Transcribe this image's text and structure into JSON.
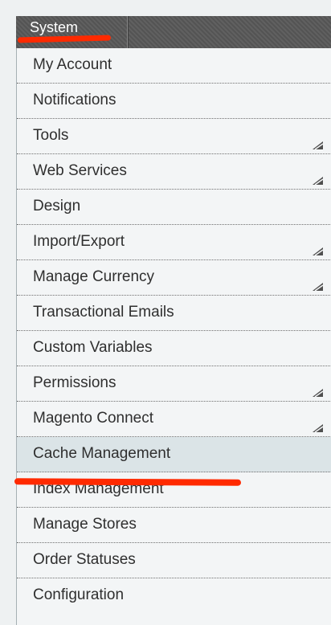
{
  "nav": {
    "system_label": "System"
  },
  "menu": {
    "items": [
      {
        "label": "My Account",
        "has_submenu": false
      },
      {
        "label": "Notifications",
        "has_submenu": false
      },
      {
        "label": "Tools",
        "has_submenu": true
      },
      {
        "label": "Web Services",
        "has_submenu": true
      },
      {
        "label": "Design",
        "has_submenu": false
      },
      {
        "label": "Import/Export",
        "has_submenu": true
      },
      {
        "label": "Manage Currency",
        "has_submenu": true
      },
      {
        "label": "Transactional Emails",
        "has_submenu": false
      },
      {
        "label": "Custom Variables",
        "has_submenu": false
      },
      {
        "label": "Permissions",
        "has_submenu": true
      },
      {
        "label": "Magento Connect",
        "has_submenu": true
      },
      {
        "label": "Cache Management",
        "has_submenu": false,
        "highlighted": true
      },
      {
        "label": "Index Management",
        "has_submenu": false
      },
      {
        "label": "Manage Stores",
        "has_submenu": false
      },
      {
        "label": "Order Statuses",
        "has_submenu": false
      },
      {
        "label": "Configuration",
        "has_submenu": false
      }
    ]
  },
  "colors": {
    "nav_bar": "#585858",
    "menu_bg": "#f3f5f6",
    "highlight_bg": "#dbe4e7",
    "annotation_mark": "#ff2a00"
  },
  "icons": {
    "submenu": "submenu-arrow-icon"
  }
}
